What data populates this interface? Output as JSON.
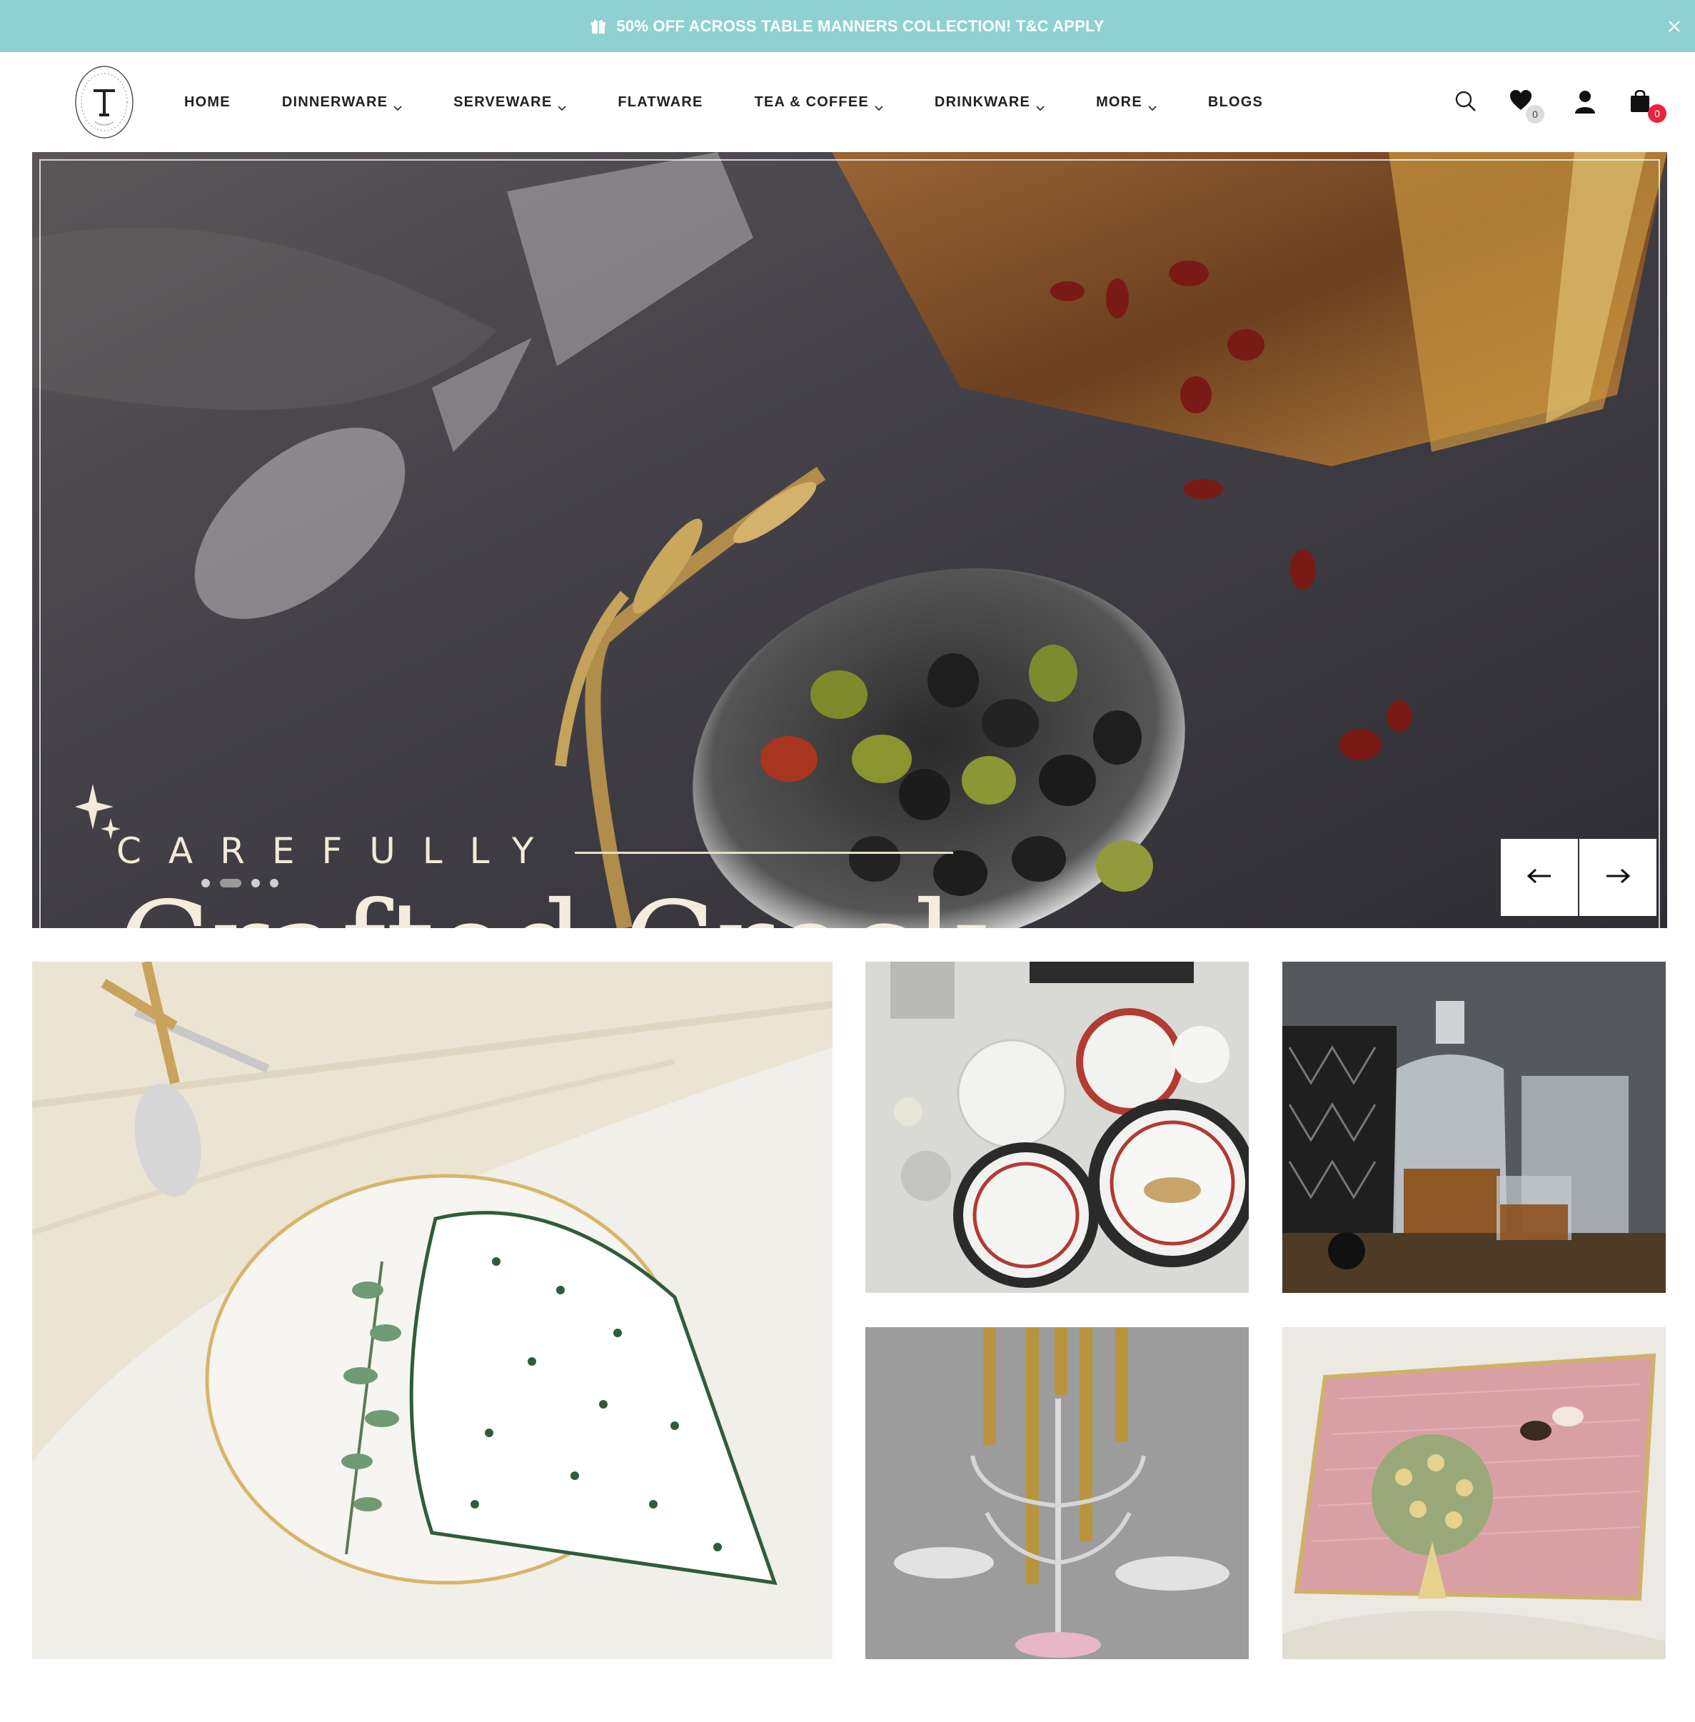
{
  "announcement": {
    "text": "50% OFF ACROSS TABLE MANNERS COLLECTION! T&C APPLY",
    "background": "#8fd1d3",
    "icon": "gift-icon",
    "close_icon": "close-icon"
  },
  "header": {
    "logo_alt": "Table Manners logo",
    "nav": [
      {
        "label": "HOME",
        "has_dropdown": false
      },
      {
        "label": "DINNERWARE",
        "has_dropdown": true
      },
      {
        "label": "SERVEWARE",
        "has_dropdown": true
      },
      {
        "label": "FLATWARE",
        "has_dropdown": false
      },
      {
        "label": "TEA & COFFEE",
        "has_dropdown": true
      },
      {
        "label": "DRINKWARE",
        "has_dropdown": true
      },
      {
        "label": "MORE",
        "has_dropdown": true
      },
      {
        "label": "BLOGS",
        "has_dropdown": false
      }
    ],
    "wishlist_count": "0",
    "cart_count": "0",
    "icons": [
      "search-icon",
      "heart-icon",
      "user-icon",
      "bag-icon"
    ]
  },
  "hero": {
    "headline": "CAREFULLY",
    "script_text": "Crafted Crock",
    "slide_count": 4,
    "active_slide": 2,
    "prev_icon": "arrow-left-icon",
    "next_icon": "arrow-right-icon"
  },
  "collections": [
    {
      "subject": "white plate with dotted scalloped napkin and cutlery"
    },
    {
      "subject": "cheetah print dinner plates"
    },
    {
      "subject": "crystal whisky decanter set"
    },
    {
      "subject": "silver candelabra with gold candles"
    },
    {
      "subject": "pink tree print tray"
    }
  ],
  "colors": {
    "accent": "#8fd1d3",
    "badge_red": "#e8243c",
    "text": "#222222"
  }
}
